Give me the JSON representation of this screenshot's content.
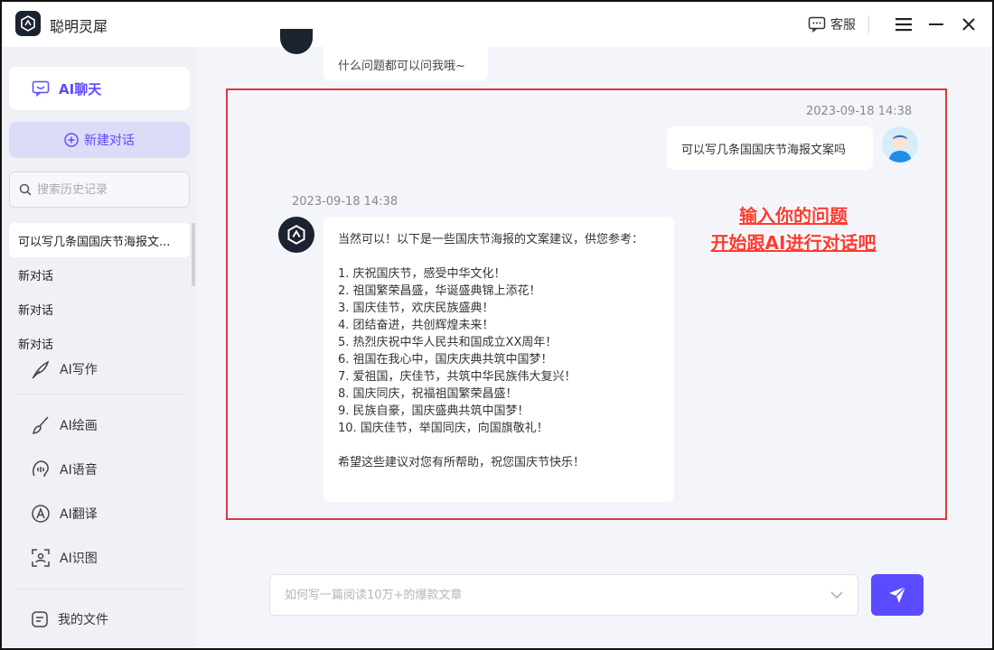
{
  "app": {
    "title": "聪明灵犀"
  },
  "titlebar": {
    "support_label": "客服"
  },
  "sidebar": {
    "chat_label": "AI聊天",
    "new_chat_label": "新建对话",
    "search_placeholder": "搜索历史记录",
    "history": [
      "可以写几条国国庆节海报文...",
      "新对话",
      "新对话",
      "新对话"
    ],
    "tools": [
      "AI写作",
      "AI绘画",
      "AI语音",
      "AI翻译",
      "AI识图"
    ],
    "my_files_label": "我的文件"
  },
  "chat": {
    "prev_ai_message": "什么问题都可以问我哦~",
    "user_timestamp": "2023-09-18 14:38",
    "user_message": "可以写几条国国庆节海报文案吗",
    "ai_timestamp": "2023-09-18 14:38",
    "ai_intro": "当然可以！以下是一些国庆节海报的文案建议，供您参考：",
    "ai_items": [
      "1. 庆祝国庆节，感受中华文化！",
      "2. 祖国繁荣昌盛，华诞盛典锦上添花！",
      "3. 国庆佳节，欢庆民族盛典！",
      "4. 团结奋进，共创辉煌未来！",
      "5. 热烈庆祝中华人民共和国成立XX周年！",
      "6. 祖国在我心中，国庆庆典共筑中国梦！",
      "7. 爱祖国，庆佳节，共筑中华民族伟大复兴！",
      "8. 国庆同庆，祝福祖国繁荣昌盛！",
      "9. 民族自豪，国庆盛典共筑中国梦！",
      "10. 国庆佳节，举国同庆，向国旗敬礼！"
    ],
    "ai_outro": "希望这些建议对您有所帮助，祝您国庆节快乐！"
  },
  "annotation": {
    "line1": "输入你的问题",
    "line2": "开始跟AI进行对话吧"
  },
  "composer": {
    "placeholder": "如何写一篇阅读10万+的爆款文章"
  },
  "colors": {
    "accent": "#5b4bff",
    "highlight": "#e0383e",
    "annotation": "#ff3b30"
  }
}
